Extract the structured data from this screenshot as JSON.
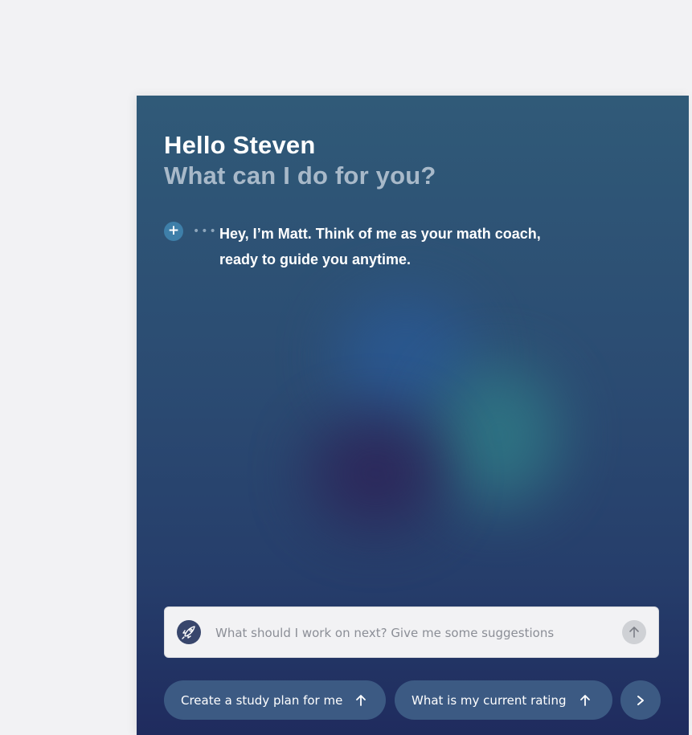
{
  "greeting": {
    "title": "Hello Steven",
    "subtitle": "What can I do for you?"
  },
  "message": {
    "text": "Hey, I’m Matt. Think of me as your math coach, ready to guide you anytime.",
    "add_icon": "plus-circle-icon",
    "typing_icon": "ellipsis-icon"
  },
  "input": {
    "placeholder": "What should I work on next? Give me some suggestions",
    "value": ""
  },
  "suggestions": [
    {
      "label": "Create a study plan for me"
    },
    {
      "label": "What is my current rating"
    }
  ],
  "colors": {
    "page_background": "#f2f2f4",
    "panel_top": "#305a78",
    "panel_bottom": "#1f2b5e",
    "chip_background": "#3c5a83",
    "accent": "#3e7fa9"
  }
}
